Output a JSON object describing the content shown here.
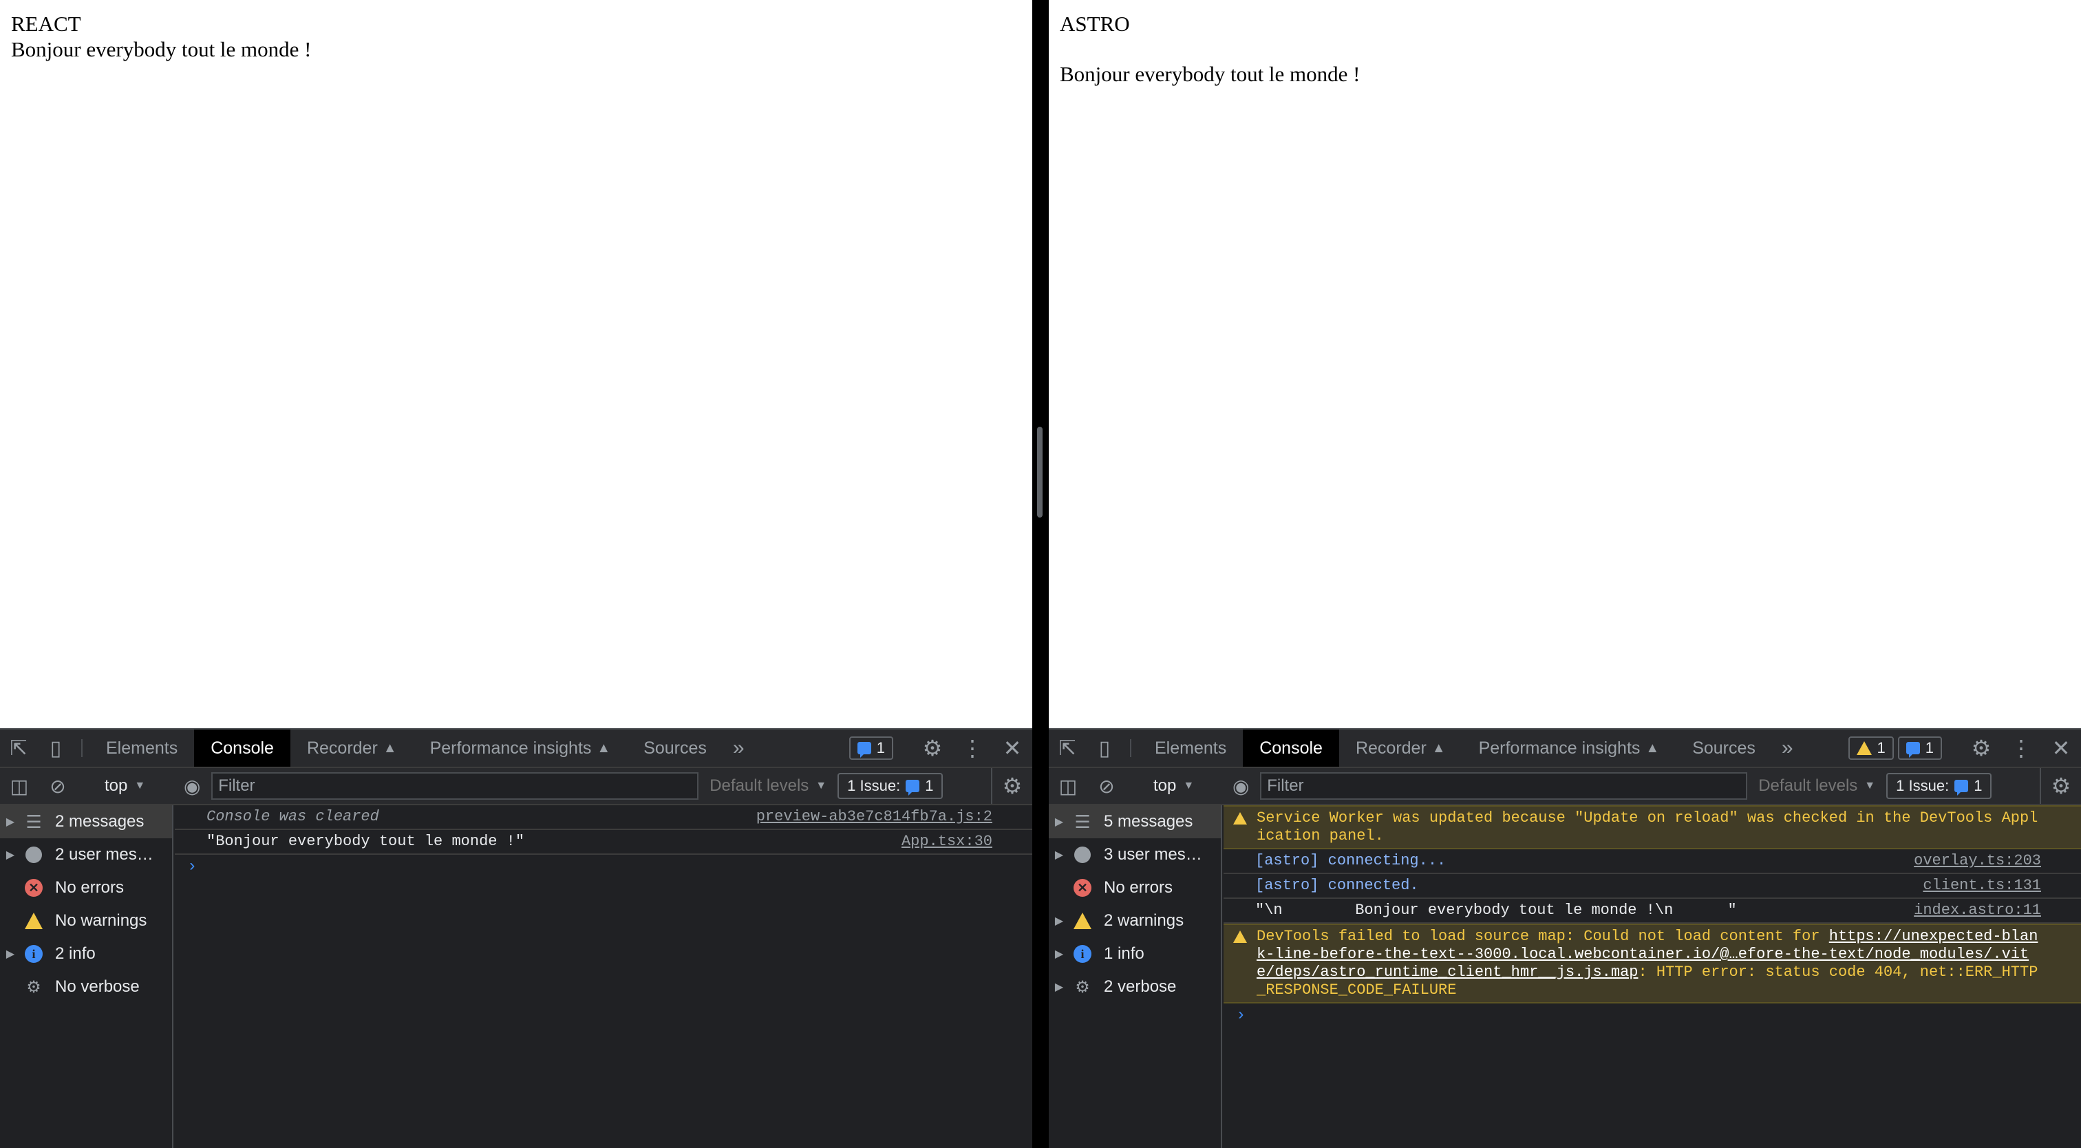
{
  "left": {
    "page": {
      "heading": "REACT",
      "text": "Bonjour everybody tout le monde !"
    },
    "devtools": {
      "tabs": [
        "Elements",
        "Console",
        "Recorder",
        "Performance insights",
        "Sources"
      ],
      "active_tab": "Console",
      "message_badge": "1",
      "context": "top",
      "filter_placeholder": "Filter",
      "levels": "Default levels",
      "issues_label": "1 Issue:",
      "issues_count": "1",
      "sidebar": [
        {
          "label": "2 messages",
          "icon": "list-icon",
          "expandable": true,
          "selected": true
        },
        {
          "label": "2 user mes…",
          "icon": "user-icon",
          "expandable": true
        },
        {
          "label": "No errors",
          "icon": "error-icon",
          "expandable": false
        },
        {
          "label": "No warnings",
          "icon": "warning-icon",
          "expandable": false
        },
        {
          "label": "2 info",
          "icon": "info-icon",
          "expandable": true
        },
        {
          "label": "No verbose",
          "icon": "verbose-icon",
          "expandable": false
        }
      ],
      "console": [
        {
          "text": "Console was cleared",
          "source": "preview-ab3e7c814fb7a.js:2",
          "kind": "muted"
        },
        {
          "text": "\"Bonjour everybody tout le monde !\"",
          "source": "App.tsx:30",
          "kind": "log"
        }
      ]
    }
  },
  "right": {
    "page": {
      "heading": "ASTRO",
      "text": "Bonjour everybody tout le monde !"
    },
    "devtools": {
      "tabs": [
        "Elements",
        "Console",
        "Recorder",
        "Performance insights",
        "Sources"
      ],
      "active_tab": "Console",
      "warning_badge": "1",
      "message_badge": "1",
      "context": "top",
      "filter_placeholder": "Filter",
      "levels": "Default levels",
      "issues_label": "1 Issue:",
      "issues_count": "1",
      "sidebar": [
        {
          "label": "5 messages",
          "icon": "list-icon",
          "expandable": true,
          "selected": true
        },
        {
          "label": "3 user mes…",
          "icon": "user-icon",
          "expandable": true
        },
        {
          "label": "No errors",
          "icon": "error-icon",
          "expandable": false
        },
        {
          "label": "2 warnings",
          "icon": "warning-icon",
          "expandable": true
        },
        {
          "label": "1 info",
          "icon": "info-icon",
          "expandable": true
        },
        {
          "label": "2 verbose",
          "icon": "verbose-icon",
          "expandable": true
        }
      ],
      "console": {
        "sw_warning": "Service Worker was updated because \"Update on reload\" was checked in the DevTools Application panel.",
        "connecting": "[astro] connecting...",
        "connecting_src": "overlay.ts:203",
        "connected": "[astro] connected.",
        "connected_src": "client.ts:131",
        "log": "\"\\n        Bonjour everybody tout le monde !\\n      \"",
        "log_src": "index.astro:11",
        "sourcemap_prefix": "DevTools failed to load source map: Could not load content for ",
        "sourcemap_url": "https://unexpected-blank-line-before-the-text--3000.local.webcontainer.io/@…efore-the-text/node_modules/.vite/deps/astro_runtime_client_hmr__js.js.map",
        "sourcemap_suffix": ": HTTP error: status code 404, net::ERR_HTTP_RESPONSE_CODE_FAILURE"
      }
    }
  }
}
